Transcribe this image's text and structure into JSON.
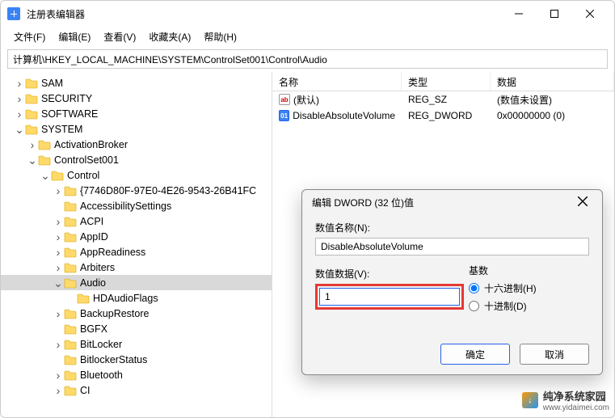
{
  "window": {
    "title": "注册表编辑器"
  },
  "menu": [
    "文件(F)",
    "编辑(E)",
    "查看(V)",
    "收藏夹(A)",
    "帮助(H)"
  ],
  "address": "计算机\\HKEY_LOCAL_MACHINE\\SYSTEM\\ControlSet001\\Control\\Audio",
  "tree": {
    "indent_base": 24,
    "items": [
      {
        "label": "SAM",
        "depth": 1,
        "twisty": "›"
      },
      {
        "label": "SECURITY",
        "depth": 1,
        "twisty": "›"
      },
      {
        "label": "SOFTWARE",
        "depth": 1,
        "twisty": "›"
      },
      {
        "label": "SYSTEM",
        "depth": 1,
        "twisty": "⌄"
      },
      {
        "label": "ActivationBroker",
        "depth": 2,
        "twisty": "›"
      },
      {
        "label": "ControlSet001",
        "depth": 2,
        "twisty": "⌄"
      },
      {
        "label": "Control",
        "depth": 3,
        "twisty": "⌄"
      },
      {
        "label": "{7746D80F-97E0-4E26-9543-26B41FC",
        "depth": 4,
        "twisty": "›"
      },
      {
        "label": "AccessibilitySettings",
        "depth": 4,
        "twisty": ""
      },
      {
        "label": "ACPI",
        "depth": 4,
        "twisty": "›"
      },
      {
        "label": "AppID",
        "depth": 4,
        "twisty": "›"
      },
      {
        "label": "AppReadiness",
        "depth": 4,
        "twisty": "›"
      },
      {
        "label": "Arbiters",
        "depth": 4,
        "twisty": "›"
      },
      {
        "label": "Audio",
        "depth": 4,
        "twisty": "⌄",
        "selected": true
      },
      {
        "label": "HDAudioFlags",
        "depth": 5,
        "twisty": ""
      },
      {
        "label": "BackupRestore",
        "depth": 4,
        "twisty": "›"
      },
      {
        "label": "BGFX",
        "depth": 4,
        "twisty": ""
      },
      {
        "label": "BitLocker",
        "depth": 4,
        "twisty": "›"
      },
      {
        "label": "BitlockerStatus",
        "depth": 4,
        "twisty": ""
      },
      {
        "label": "Bluetooth",
        "depth": 4,
        "twisty": "›"
      },
      {
        "label": "CI",
        "depth": 4,
        "twisty": "›"
      }
    ]
  },
  "list": {
    "headers": {
      "name": "名称",
      "type": "类型",
      "data": "数据"
    },
    "rows": [
      {
        "icon": "str",
        "iconGlyph": "ab",
        "name": "(默认)",
        "type": "REG_SZ",
        "data": "(数值未设置)"
      },
      {
        "icon": "bin",
        "iconGlyph": "01",
        "name": "DisableAbsoluteVolume",
        "type": "REG_DWORD",
        "data": "0x00000000 (0)"
      }
    ]
  },
  "dialog": {
    "title": "编辑 DWORD (32 位)值",
    "name_label": "数值名称(N):",
    "name_value": "DisableAbsoluteVolume",
    "data_label": "数值数据(V):",
    "data_value": "1",
    "base_label": "基数",
    "radio_hex": "十六进制(H)",
    "radio_dec": "十进制(D)",
    "ok": "确定",
    "cancel": "取消"
  },
  "watermark": {
    "brand": "纯净系统家园",
    "url": "www.yidaimei.com"
  }
}
